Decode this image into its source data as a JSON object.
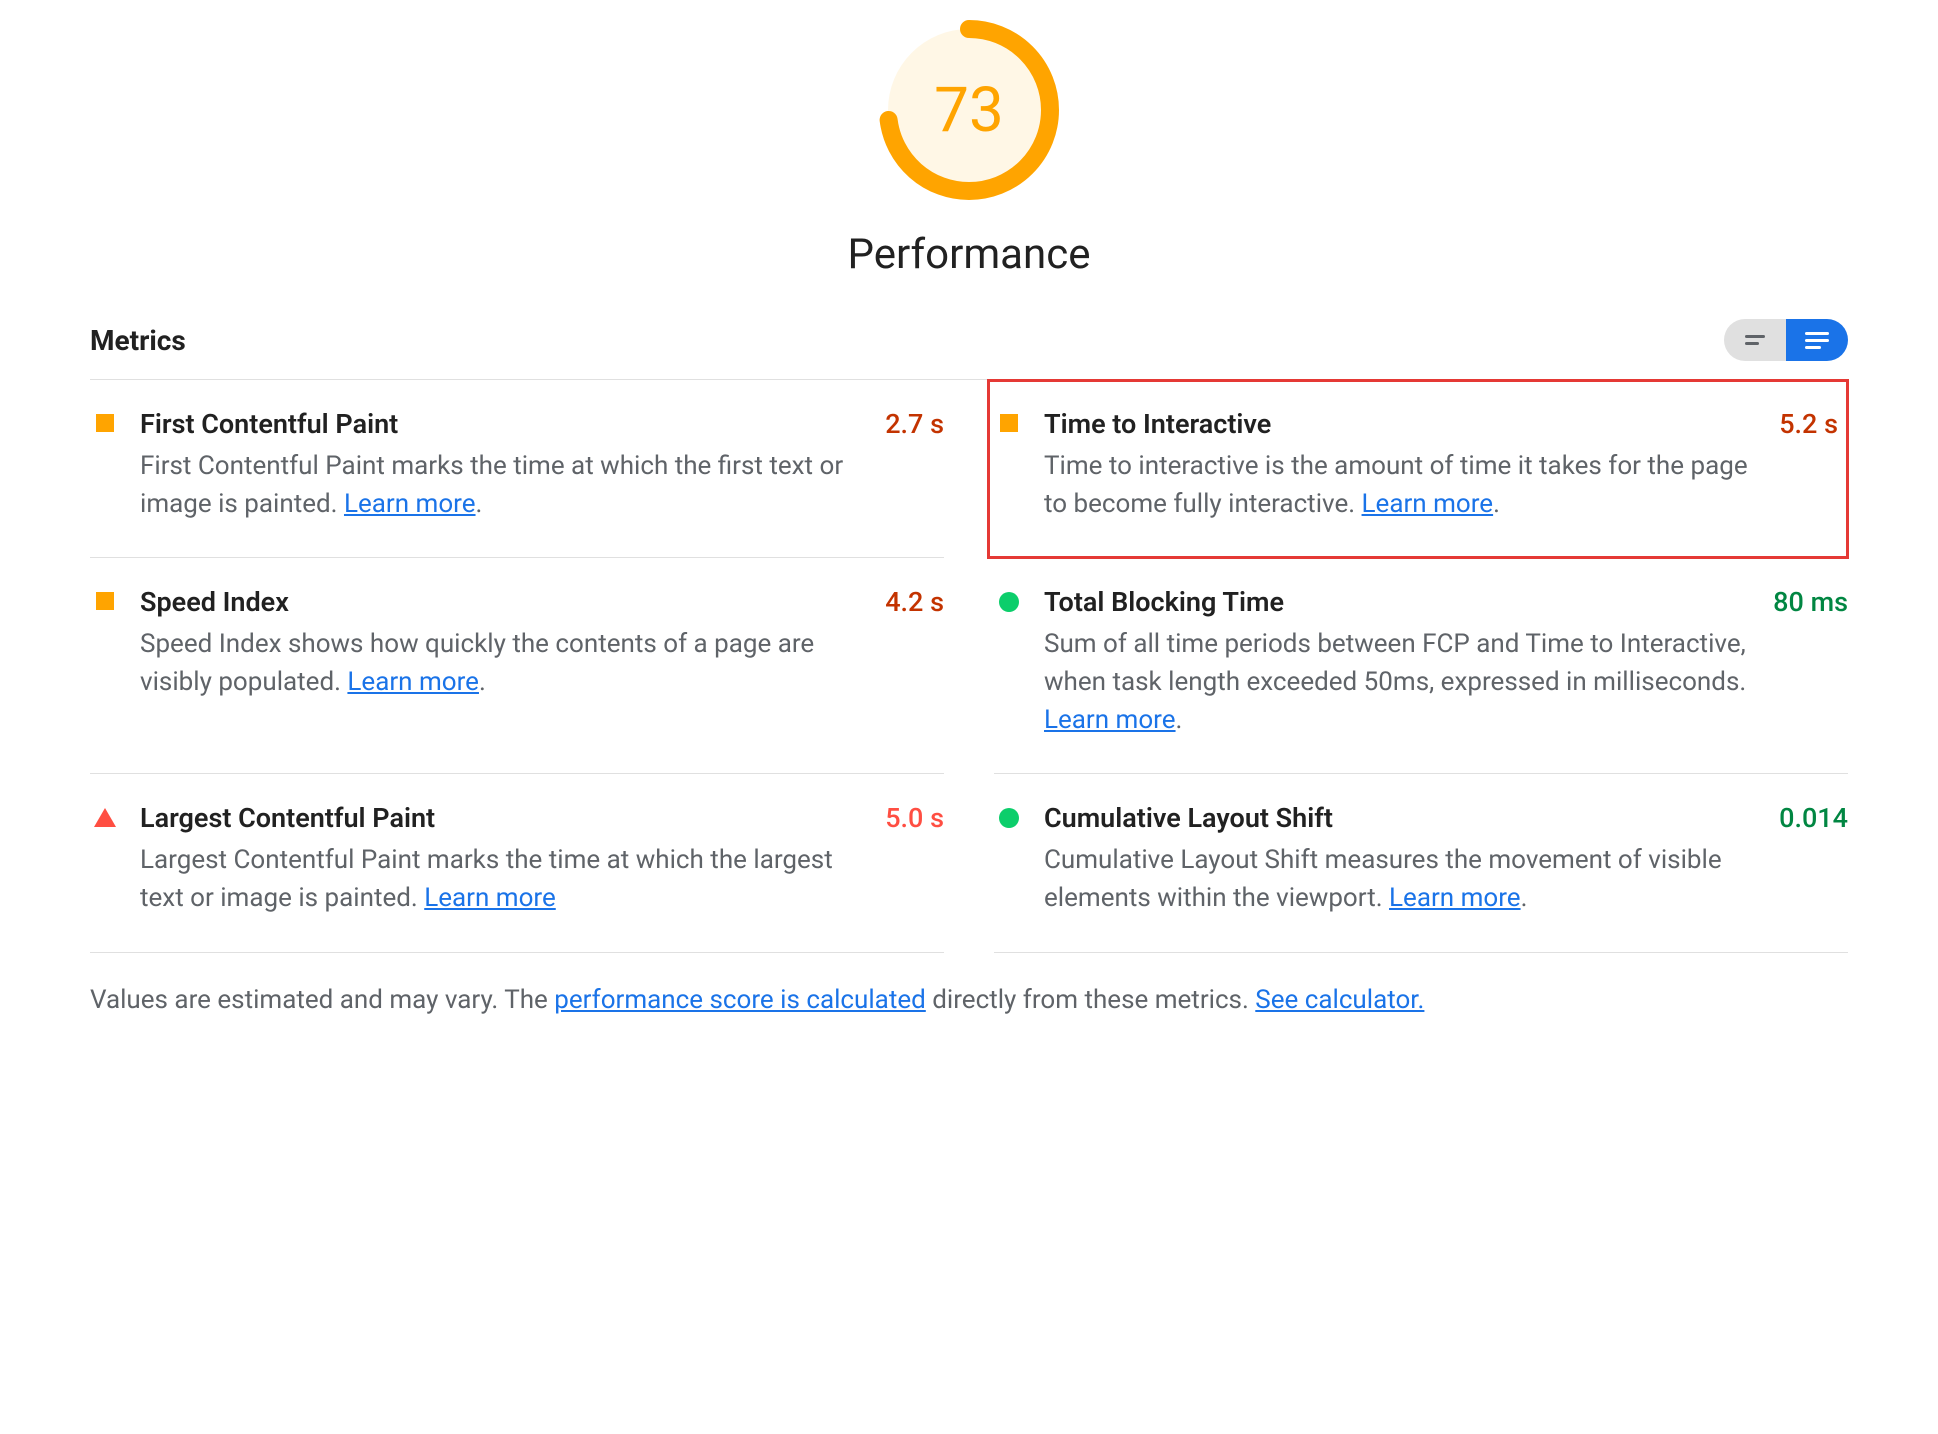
{
  "gauge": {
    "score": "73",
    "label": "Performance",
    "percent": 73
  },
  "metrics_header": "Metrics",
  "learn_more": "Learn more",
  "metrics": {
    "fcp": {
      "title": "First Contentful Paint",
      "desc_pre": "First Contentful Paint marks the time at which the first text or image is painted. ",
      "desc_post": ".",
      "value": "2.7 s",
      "status": "orange"
    },
    "tti": {
      "title": "Time to Interactive",
      "desc_pre": "Time to interactive is the amount of time it takes for the page to become fully interactive. ",
      "desc_post": ".",
      "value": "5.2 s",
      "status": "orange",
      "highlight": true
    },
    "si": {
      "title": "Speed Index",
      "desc_pre": "Speed Index shows how quickly the contents of a page are visibly populated. ",
      "desc_post": ".",
      "value": "4.2 s",
      "status": "orange"
    },
    "tbt": {
      "title": "Total Blocking Time",
      "desc_pre": "Sum of all time periods between FCP and Time to Interactive, when task length exceeded 50ms, expressed in milliseconds. ",
      "desc_post": ".",
      "value": "80 ms",
      "status": "green"
    },
    "lcp": {
      "title": "Largest Contentful Paint",
      "desc_pre": "Largest Contentful Paint marks the time at which the largest text or image is painted. ",
      "desc_post": "",
      "value": "5.0 s",
      "status": "red"
    },
    "cls": {
      "title": "Cumulative Layout Shift",
      "desc_pre": "Cumulative Layout Shift measures the movement of visible elements within the viewport. ",
      "desc_post": ".",
      "value": "0.014",
      "status": "green"
    }
  },
  "footnote": {
    "pre": "Values are estimated and may vary. The ",
    "link1": "performance score is calculated",
    "mid": " directly from these metrics. ",
    "link2": "See calculator."
  },
  "colors": {
    "orange": "#ffa400",
    "green": "#0cce6b",
    "red": "#ff4e42"
  }
}
